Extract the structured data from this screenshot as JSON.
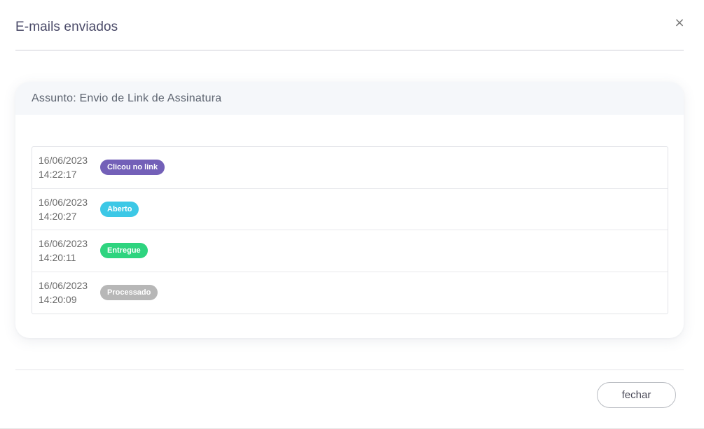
{
  "modal": {
    "title": "E-mails enviados",
    "close_icon": "×",
    "footer_button": "fechar"
  },
  "email": {
    "subject": "Assunto: Envio de Link de Assinatura",
    "events": [
      {
        "date": "16/06/2023",
        "time": "14:22:17",
        "status": "Clicou no link",
        "color": "#7360b8"
      },
      {
        "date": "16/06/2023",
        "time": "14:20:27",
        "status": "Aberto",
        "color": "#3cc8e6"
      },
      {
        "date": "16/06/2023",
        "time": "14:20:11",
        "status": "Entregue",
        "color": "#2ed47f"
      },
      {
        "date": "16/06/2023",
        "time": "14:20:09",
        "status": "Processado",
        "color": "#b7b7b7"
      }
    ]
  }
}
